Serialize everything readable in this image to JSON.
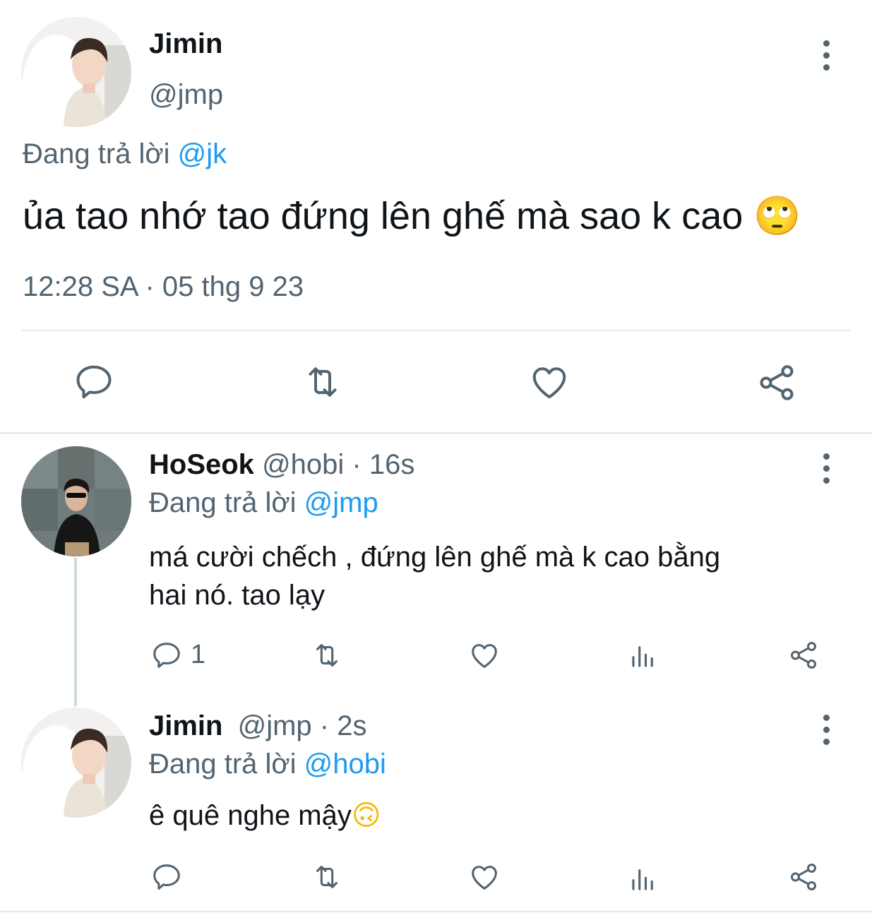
{
  "main_tweet": {
    "display_name": "Jimin",
    "handle": "@jmp",
    "replying_prefix": "Đang trả lời",
    "replying_to": "@jk",
    "text": "ủa tao nhớ tao đứng lên ghế mà sao k cao",
    "emoji": "🙄",
    "timestamp": "12:28 SA · 05 thg 9 23",
    "actions": [
      "reply",
      "retweet",
      "like",
      "share"
    ]
  },
  "replies": [
    {
      "display_name": "HoSeok",
      "handle": "@hobi",
      "dot": "·",
      "time": "16s",
      "replying_prefix": "Đang trả lời",
      "replying_to": "@jmp",
      "text_line1": "má cười chếch , đứng lên ghế mà k cao bằng",
      "text_line2": "hai nó. tao lạy",
      "reply_count": "1"
    },
    {
      "display_name": "Jimin",
      "handle": "@jmp",
      "dot": "·",
      "time": "2s",
      "replying_prefix": "Đang trả lời",
      "replying_to": "@hobi",
      "text": "ê quê nghe mậy",
      "emoji": "🙃",
      "reply_count": ""
    }
  ],
  "colors": {
    "text": "#0f1419",
    "muted": "#536471",
    "link": "#1d9bf0",
    "divider": "#e6ecf0"
  }
}
